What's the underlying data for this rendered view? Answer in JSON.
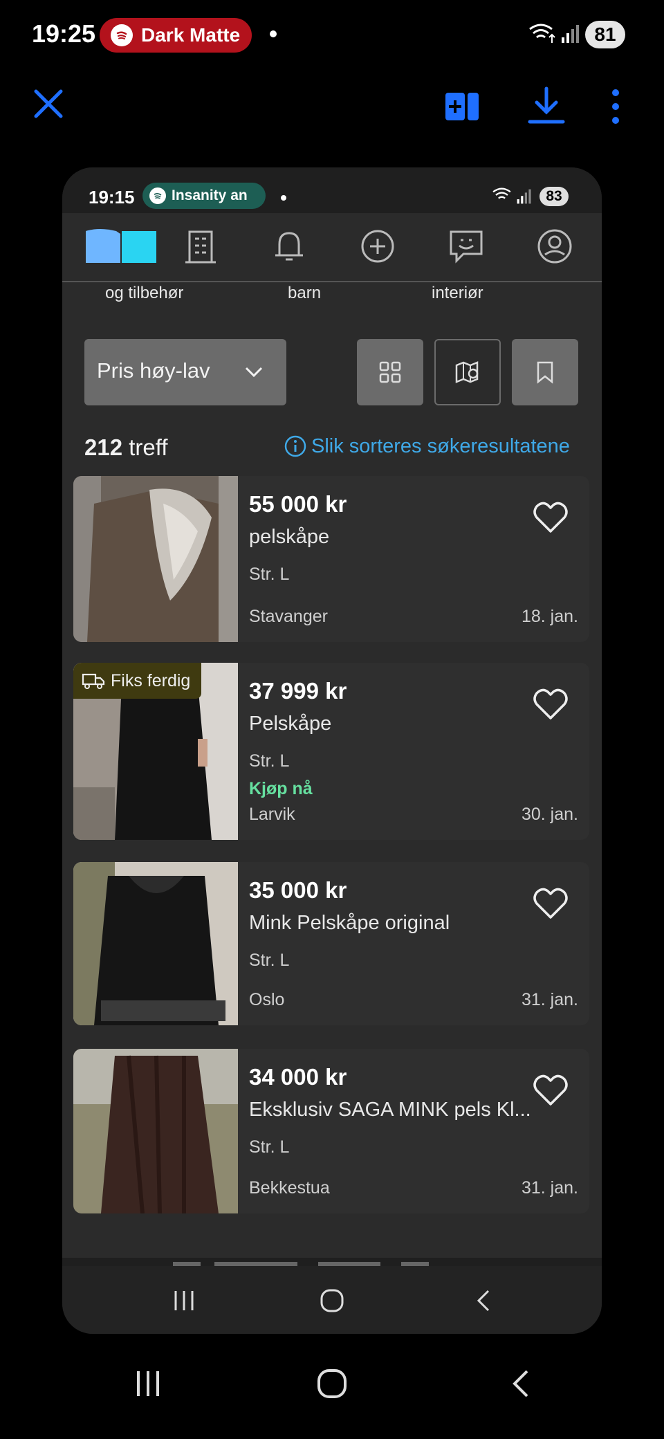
{
  "outer_status": {
    "time": "19:25",
    "media_label": "Dark Matte",
    "battery": "81"
  },
  "inner_status": {
    "time": "19:15",
    "media_label": "Insanity an",
    "battery": "83"
  },
  "categories": [
    "og tilbehør",
    "barn",
    "interiør"
  ],
  "sort": {
    "label": "Pris høy-lav"
  },
  "results": {
    "count": "212",
    "suffix": " treff",
    "info_link": "Slik sorteres søkeresultatene"
  },
  "listings": [
    {
      "price": "55 000 kr",
      "title": "pelskåpe",
      "size": "Str. L",
      "location": "Stavanger",
      "date": "18. jan."
    },
    {
      "price": "37 999 kr",
      "title": "Pelskåpe",
      "size": "Str. L",
      "buy_now": "Kjøp nå",
      "badge": "Fiks ferdig",
      "location": "Larvik",
      "date": "30. jan."
    },
    {
      "price": "35 000 kr",
      "title": "Mink Pelskåpe original",
      "size": "Str. L",
      "location": "Oslo",
      "date": "31. jan."
    },
    {
      "price": "34 000 kr",
      "title": "Eksklusiv SAGA MINK pels Kl...",
      "size": "Str. L",
      "location": "Bekkestua",
      "date": "31. jan."
    }
  ],
  "colors": {
    "accent_blue": "#1f6fff",
    "link_blue": "#3fa9e8",
    "buy_green": "#66e0a0",
    "spotify_red": "#b3121c",
    "spotify_teal": "#1d5e54"
  },
  "icons": [
    "close-icon",
    "add-panel-icon",
    "download-icon",
    "more-vertical-icon",
    "home-icon",
    "building-icon",
    "bell-icon",
    "plus-circle-icon",
    "chat-icon",
    "profile-icon",
    "grid-icon",
    "map-icon",
    "bookmark-icon",
    "heart-icon",
    "truck-icon",
    "info-icon"
  ]
}
